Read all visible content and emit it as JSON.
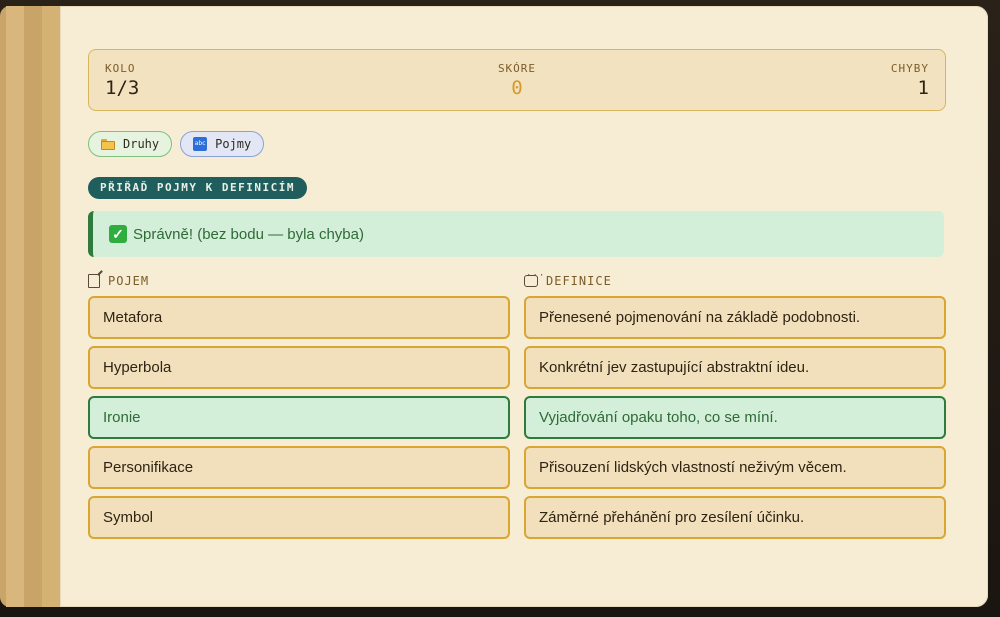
{
  "stats": {
    "kolo_label": "KOLO",
    "kolo_value": "1/3",
    "skore_label": "SKÓRE",
    "skore_value": "0",
    "chyby_label": "CHYBY",
    "chyby_value": "1"
  },
  "chips": [
    {
      "label": "Druhy",
      "icon": "folder-icon"
    },
    {
      "label": "Pojmy",
      "icon": "abc-icon"
    }
  ],
  "instruction": "PŘIŘAĎ POJMY K DEFINICÍM",
  "feedback": {
    "text": "Správně! (bez bodu — byla chyba)",
    "icon": "check-icon"
  },
  "columns": {
    "left_header": "POJEM",
    "right_header": "DEFINICE"
  },
  "terms": [
    "Metafora",
    "Hyperbola",
    "Ironie",
    "Personifikace",
    "Symbol"
  ],
  "definitions": [
    "Přenesené pojmenování na základě podobnosti.",
    "Konkrétní jev zastupující abstraktní ideu.",
    "Vyjadřování opaku toho, co se míní.",
    "Přisouzení lidských vlastností neživým věcem.",
    "Záměrné přehánění pro zesílení účinku."
  ],
  "matched": {
    "term": "Ironie",
    "definition": "Vyjadřování opaku toho, co se míní."
  },
  "colors": {
    "accent": "#d9a632",
    "success": "#2f7a3d",
    "score": "#d49a2a"
  }
}
